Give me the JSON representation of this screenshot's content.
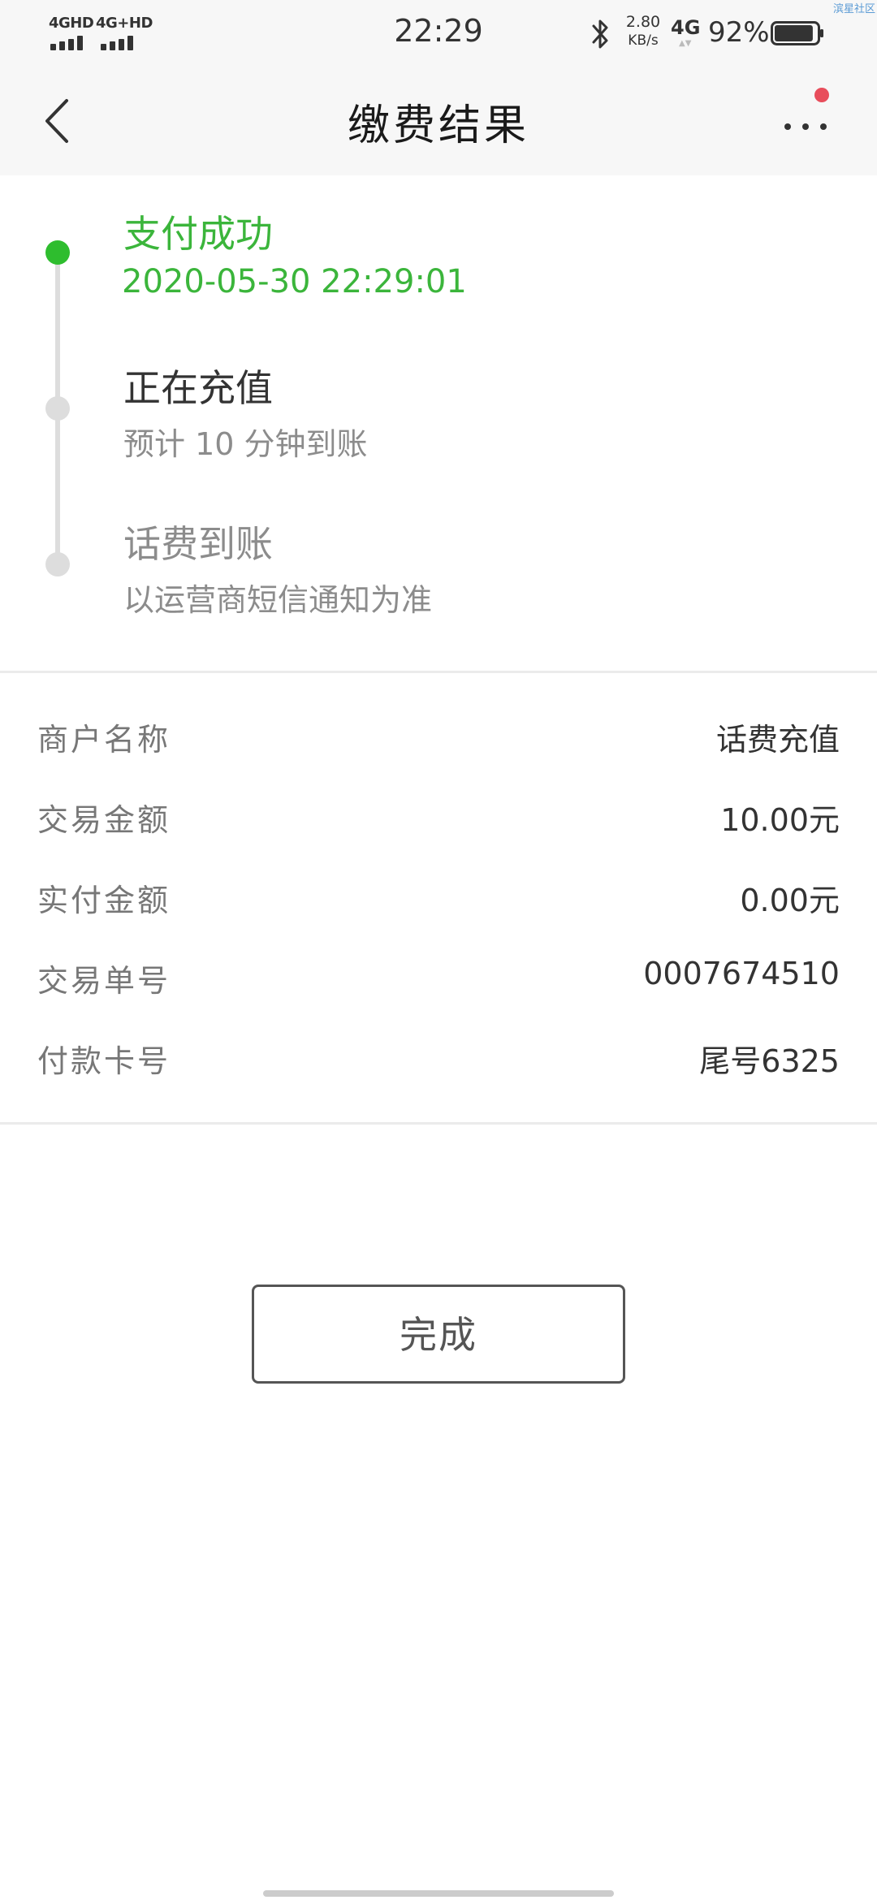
{
  "status_bar": {
    "sim1_tech": "4GHD",
    "sim2_tech": "4G+HD",
    "time": "22:29",
    "speed_value": "2.80",
    "speed_unit": "KB/s",
    "network": "4G",
    "battery_text": "92%",
    "battery_level": 0.92,
    "watermark": "滨星社区"
  },
  "nav": {
    "title": "缴费结果"
  },
  "timeline": {
    "steps": [
      {
        "title": "支付成功",
        "subtitle": "2020-05-30 22:29:01",
        "state": "done"
      },
      {
        "title": "正在充值",
        "subtitle": "预计 10 分钟到账",
        "state": "current"
      },
      {
        "title": "话费到账",
        "subtitle": "以运营商短信通知为准",
        "state": "pending"
      }
    ]
  },
  "details": {
    "rows": [
      {
        "label": "商户名称",
        "value": "话费充值"
      },
      {
        "label": "交易金额",
        "value": "10.00元"
      },
      {
        "label": "实付金额",
        "value": "0.00元"
      },
      {
        "label": "交易单号",
        "value": "0007674510"
      },
      {
        "label": "付款卡号",
        "value": "尾号6325"
      }
    ]
  },
  "actions": {
    "done_label": "完成"
  },
  "colors": {
    "success_green": "#2ebd2e",
    "notification_red": "#e84d5b",
    "header_bg": "#f7f7f7"
  },
  "icons": {
    "back": "chevron-left-icon",
    "more": "more-dots-icon",
    "bluetooth": "bluetooth-icon",
    "battery": "battery-icon"
  }
}
